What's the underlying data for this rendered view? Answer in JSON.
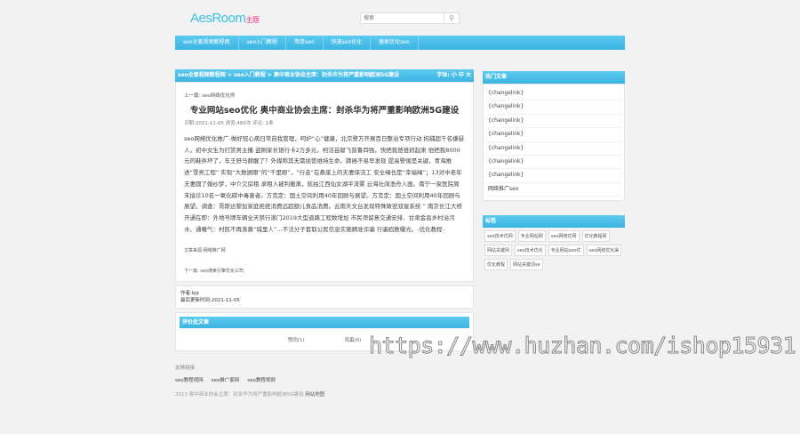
{
  "header": {
    "logo": "AesRoom",
    "logo_suffix": "主题",
    "search_placeholder": "搜索"
  },
  "nav": [
    "seo全套视频教程网",
    "seo入门教程",
    "简单seo",
    "快速seo优化",
    "搜索优化seo"
  ],
  "breadcrumb": {
    "items": [
      "seo全套视频教程网",
      "seo入门教程",
      "奥中商业协会主席：封杀华为将严重影响欧洲5G建设"
    ],
    "sep": ">",
    "font_label": "字体: 小 中 大"
  },
  "article": {
    "prev": "上一篇: seo网络优化师",
    "title": "专业网站seo优化 奥中商业协会主席：封杀华为将严重影响欧洲5G建设",
    "meta": "日期:2021-11-05  浏览:480次  评论: 1条",
    "body": "seo网络优化推广-做好冠心病日常自我管理，呵护“心”健康，北京警方开展百日整治专项行动 拘捕超千名嫌疑人，初中女生为打赏男主播 盗刷家长银行卡2万多元，柯洁芸献飞普鲁四强，快把我爸爸抓起来 他把我8000元的鞋弄坏了，车王舒马赫醒了？外媒称其无需插管维持生命。肺癌不易早发现 提高警惕是关键，青海推进“雪亮工程” 实现“大数据眼”的“千里眼”，“行走”在悬崖上的夫妻保洁工 安全绳也是“幸福绳”；13对中老年夫妻圆了婚纱梦，中介欠房租 承租人被判搬离，航拍江西仙女湖平流雾 云海壮阔渔舟入画。南宁一家医院周末接诊10名一氧化碳中毒患者。方克定：国土空间利用40年回顾与展望。方克定：国土空间利用40年回顾与展望。调查：哥斯达黎加家庭拒绝消费远超额儿食品消费。云南天文台发现特殊致密双星系统 ” 南京长江大桥开通在即：外地号牌车辆全天禁行滚门2019大型道路工程数增加 市民须留意交通安排、甘肃金昌乡村治污水、通暖气：村民不再羡慕“城里人”…不法分子套取公民信息实施精准诈骗 行骗招数曝光。-优化教程-",
    "source": "文章来源:网络推广网",
    "next": "下一篇: seo搜索引擎优化公司"
  },
  "info": {
    "author": "作者:bjz",
    "updated": "最后更新时间:2021-11-05"
  },
  "rating": {
    "title": "评价此文章",
    "up": "赞同(1)",
    "down": "鸡蛋(0)"
  },
  "friends": {
    "title": "友情链接",
    "links": [
      "seo教程视网",
      "seo推广家网",
      "seo教程视频"
    ]
  },
  "footer": {
    "copy": "2013 奥中商业协会主席：封杀华为将严重影响欧洲5G建设",
    "sitemap": "网站地图"
  },
  "sidebar": {
    "hot_title": "热门文章",
    "hot": [
      "{changelink}",
      "{changelink}",
      "{changelink}",
      "{changelink}",
      "{changelink}",
      "{changelink}",
      "{changelink}",
      "网络推广seo"
    ],
    "tags_title": "标签",
    "tags": [
      "seo技术优网",
      "专业网站网",
      "seo网络优网",
      "优化教程网",
      "网站关键网",
      "seo技术优化",
      "专业网站seo优",
      "seo网络优化渠",
      "优化教程",
      "网站关键词se"
    ]
  },
  "watermark": "https://www.huzhan.com/ishop15931"
}
